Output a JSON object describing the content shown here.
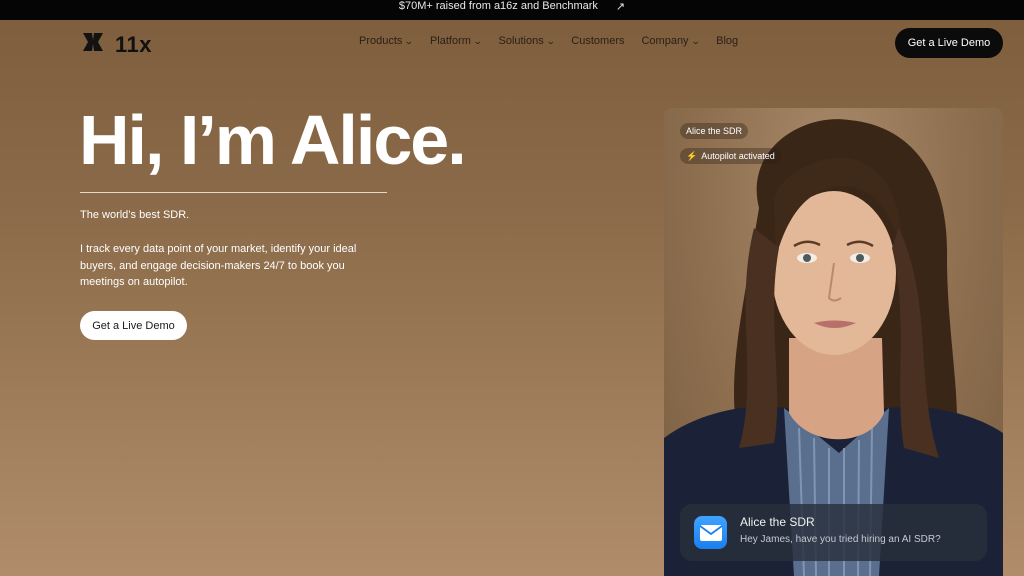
{
  "announcement": {
    "text": "$70M+ raised from a16z and Benchmark",
    "arrow": "↗"
  },
  "nav": {
    "logo_text": "11x",
    "items": [
      {
        "label": "Products",
        "dropdown": true
      },
      {
        "label": "Platform",
        "dropdown": true
      },
      {
        "label": "Solutions",
        "dropdown": true
      },
      {
        "label": "Customers",
        "dropdown": false
      },
      {
        "label": "Company",
        "dropdown": true
      },
      {
        "label": "Blog",
        "dropdown": false
      }
    ],
    "cta_label": "Get a Live Demo"
  },
  "hero": {
    "title": "Hi, I’m Alice.",
    "tagline": "The world’s best SDR.",
    "description": "I track every data point of your market, identify your ideal buyers, and engage decision-makers 24/7 to book you meetings on autopilot.",
    "cta_label": "Get a Live Demo"
  },
  "agent_card": {
    "name_chip": "Alice the SDR",
    "status_chip": "Autopilot activated",
    "notification": {
      "title": "Alice the SDR",
      "message": "Hey James, have you tried hiring an AI SDR?"
    }
  },
  "colors": {
    "background_top": "#7e5d3c",
    "background_bottom": "#b08c6b",
    "button_dark": "#0b0b0b",
    "mail_icon": "#1a7ff0"
  }
}
